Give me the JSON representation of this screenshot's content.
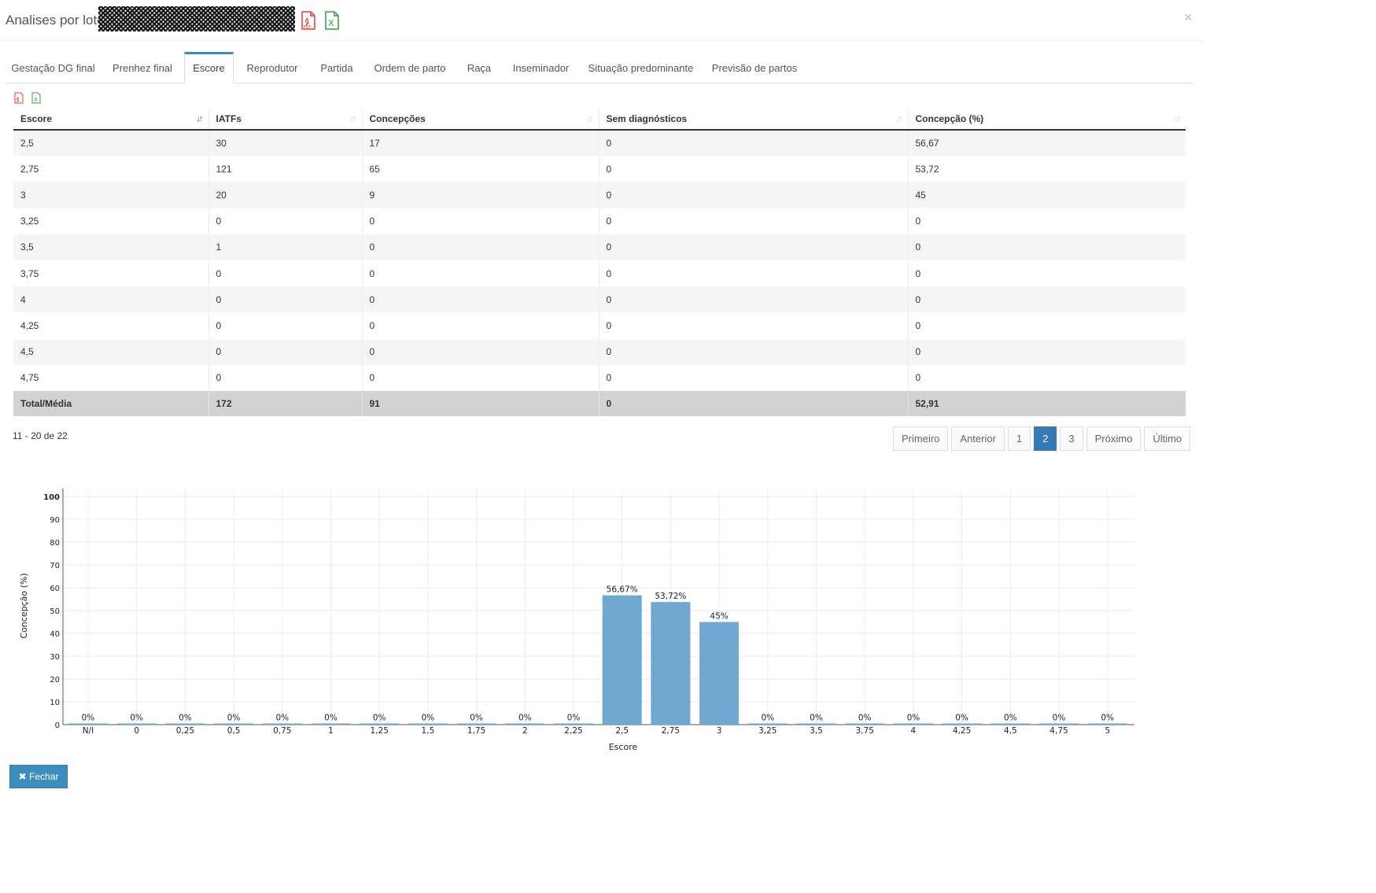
{
  "modal": {
    "title": "Analises por lotes",
    "close": "×"
  },
  "tabs": [
    {
      "label": "Gestação DG final"
    },
    {
      "label": "Prenhez final"
    },
    {
      "label": "Escore",
      "active": true
    },
    {
      "label": "Reprodutor"
    },
    {
      "label": "Partida"
    },
    {
      "label": "Ordem de parto"
    },
    {
      "label": "Raça"
    },
    {
      "label": "Inseminador"
    },
    {
      "label": "Situação predominante"
    },
    {
      "label": "Previsão de partos"
    }
  ],
  "table": {
    "headers": [
      "Escore",
      "IATFs",
      "Concepções",
      "Sem diagnósticos",
      "Concepção (%)"
    ],
    "rows": [
      [
        "2,5",
        "30",
        "17",
        "0",
        "56,67"
      ],
      [
        "2,75",
        "121",
        "65",
        "0",
        "53,72"
      ],
      [
        "3",
        "20",
        "9",
        "0",
        "45"
      ],
      [
        "3,25",
        "0",
        "0",
        "0",
        "0"
      ],
      [
        "3,5",
        "1",
        "0",
        "0",
        "0"
      ],
      [
        "3,75",
        "0",
        "0",
        "0",
        "0"
      ],
      [
        "4",
        "0",
        "0",
        "0",
        "0"
      ],
      [
        "4,25",
        "0",
        "0",
        "0",
        "0"
      ],
      [
        "4,5",
        "0",
        "0",
        "0",
        "0"
      ],
      [
        "4,75",
        "0",
        "0",
        "0",
        "0"
      ]
    ],
    "footer": [
      "Total/Média",
      "172",
      "91",
      "0",
      "52,91"
    ]
  },
  "pagination": {
    "info": "11 - 20 de 22",
    "first": "Primeiro",
    "prev": "Anterior",
    "pages": [
      "1",
      "2",
      "3"
    ],
    "current": "2",
    "next": "Próximo",
    "last": "Último"
  },
  "icons": {
    "pdf": "pdf-icon",
    "excel": "excel-icon",
    "close": "close-icon",
    "fechar": "times-icon"
  },
  "colors": {
    "bar": "#6fa8d1",
    "accent": "#3c8dbc",
    "pdf": "#e53935",
    "excel": "#2e9e44"
  },
  "chart_data": {
    "type": "bar",
    "categories": [
      "N/I",
      "0",
      "0,25",
      "0,5",
      "0,75",
      "1",
      "1,25",
      "1,5",
      "1,75",
      "2",
      "2,25",
      "2,5",
      "2,75",
      "3",
      "3,25",
      "3,5",
      "3,75",
      "4",
      "4,25",
      "4,5",
      "4,75",
      "5"
    ],
    "values": [
      0,
      0,
      0,
      0,
      0,
      0,
      0,
      0,
      0,
      0,
      0,
      56.67,
      53.72,
      45,
      0,
      0,
      0,
      0,
      0,
      0,
      0,
      0
    ],
    "value_labels": [
      "0%",
      "0%",
      "0%",
      "0%",
      "0%",
      "0%",
      "0%",
      "0%",
      "0%",
      "0%",
      "0%",
      "56,67%",
      "53,72%",
      "45%",
      "0%",
      "0%",
      "0%",
      "0%",
      "0%",
      "0%",
      "0%",
      "0%"
    ],
    "yticks": [
      "0",
      "10",
      "20",
      "30",
      "40",
      "50",
      "60",
      "70",
      "80",
      "90",
      "100"
    ],
    "xlabel": "Escore",
    "ylabel": "Concepção (%)",
    "ylim": [
      0,
      100
    ],
    "grid": true
  },
  "footer": {
    "close_button": "Fechar"
  }
}
